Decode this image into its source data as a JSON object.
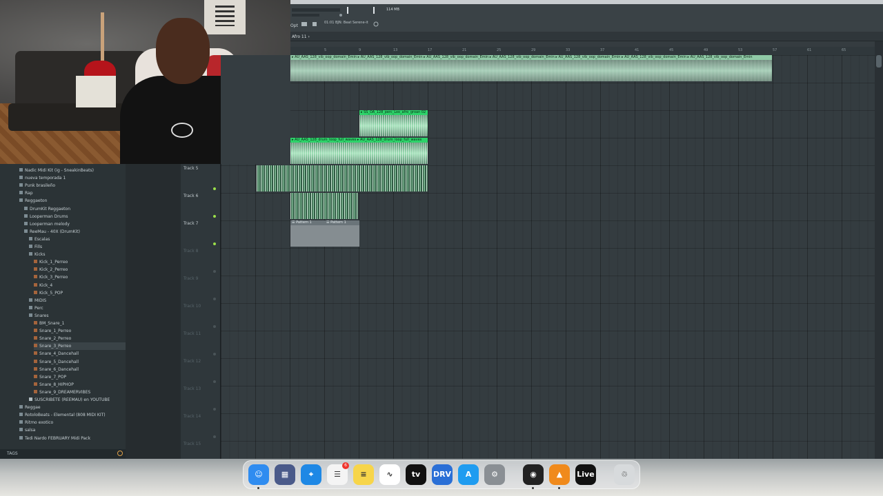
{
  "playlist": {
    "pattern_title": "Afro 11 ›",
    "opt_label": "Opt",
    "cpu_readout": "114 MB",
    "hint_text": "01:01 BJN: Beat Serene-it"
  },
  "timeline": {
    "ticks": [
      "5",
      "9",
      "13",
      "17",
      "21",
      "25",
      "29",
      "33",
      "37",
      "41",
      "45",
      "49",
      "53",
      "57",
      "61",
      "65",
      "69",
      "73"
    ]
  },
  "tracks": [
    {
      "label": "Track 5",
      "active": true
    },
    {
      "label": "Track 6",
      "active": true
    },
    {
      "label": "Track 7",
      "active": true
    },
    {
      "label": "Track 8",
      "active": false
    },
    {
      "label": "Track 9",
      "active": false
    },
    {
      "label": "Track 10",
      "active": false
    },
    {
      "label": "Track 11",
      "active": false
    },
    {
      "label": "Track 12",
      "active": false
    },
    {
      "label": "Track 13",
      "active": false
    },
    {
      "label": "Track 14",
      "active": false
    },
    {
      "label": "Track 15",
      "active": false
    }
  ],
  "clips": {
    "vocal_loop_label": "▸ AU_AAS_128_vib_oop_domain_Emin ▸ AU_AAS_128_vib_oop_domain_Emin ▸ AU_AAS_128_vib_oop_domain_Emin ▸ AU_AAS_128_vib_oop_domain_Emin ▸ AU_AAS_128_vib_oop_domain_Emin ▸ AU_AAS_128_vib_oop_domain_Emin ▸ AU_AAS_128_vib_oop_domain_Emin",
    "perc_loop_label": "▸ SS_OA_128_perc_Loo_afro_groan 02",
    "drum_loop_label": "▸ AU_AAS_128_drum_loop_full_waves ▸ AU_AAS_128_drum_loop_full_waves",
    "pattern_1_label": "☰ Pattern 1",
    "pattern_2_label": "☰ Pattern 1"
  },
  "browser": {
    "items": [
      {
        "label": "Nadic Midi Kit (ig - SneakinBeats)",
        "type": "folder",
        "indent": 0
      },
      {
        "label": "nueva temporada 1",
        "type": "folder",
        "indent": 0
      },
      {
        "label": "Punk brasileño",
        "type": "folder",
        "indent": 0
      },
      {
        "label": "Rap",
        "type": "folder",
        "indent": 0
      },
      {
        "label": "Reggaeton",
        "type": "folder",
        "indent": 0
      },
      {
        "label": "DrumKit Reggaeton",
        "type": "folder",
        "indent": 1
      },
      {
        "label": "Looperman Drums",
        "type": "folder",
        "indent": 1
      },
      {
        "label": "Looperman melody",
        "type": "folder",
        "indent": 1
      },
      {
        "label": "ReeMau - 40X (DrumKit)",
        "type": "folder",
        "indent": 1
      },
      {
        "label": "Escalas",
        "type": "folder",
        "indent": 2
      },
      {
        "label": "Fills",
        "type": "folder",
        "indent": 2
      },
      {
        "label": "Kicks",
        "type": "folder",
        "indent": 2
      },
      {
        "label": "Kick_1_Perreo",
        "type": "file",
        "indent": 3
      },
      {
        "label": "Kick_2_Perreo",
        "type": "file",
        "indent": 3
      },
      {
        "label": "Kick_3_Perreo",
        "type": "file",
        "indent": 3
      },
      {
        "label": "Kick_4",
        "type": "file",
        "indent": 3
      },
      {
        "label": "Kick_5_POP",
        "type": "file",
        "indent": 3
      },
      {
        "label": "MIDIS",
        "type": "folder",
        "indent": 2
      },
      {
        "label": "Perc",
        "type": "folder",
        "indent": 2
      },
      {
        "label": "Snares",
        "type": "folder",
        "indent": 2
      },
      {
        "label": "BM_Snare_1",
        "type": "file",
        "indent": 3
      },
      {
        "label": "Snare_1_Perreo",
        "type": "file",
        "indent": 3
      },
      {
        "label": "Snare_2_Perreo",
        "type": "file",
        "indent": 3
      },
      {
        "label": "Snare_3_Perreo",
        "type": "file",
        "indent": 3
      },
      {
        "label": "Snare_4_Dancehall",
        "type": "file",
        "indent": 3
      },
      {
        "label": "Snare_5_Dancehall",
        "type": "file",
        "indent": 3
      },
      {
        "label": "Snare_6_Dancehall",
        "type": "file",
        "indent": 3
      },
      {
        "label": "Snare_7_POP",
        "type": "file",
        "indent": 3
      },
      {
        "label": "Snare_8_HIPHOP",
        "type": "file",
        "indent": 3
      },
      {
        "label": "Snare_9_DREAMERVIBES",
        "type": "file",
        "indent": 3
      },
      {
        "label": "SUSCRIBETE (REEMAU) en YOUTUBE",
        "type": "audio",
        "indent": 2
      },
      {
        "label": "Reggae",
        "type": "folder",
        "indent": 0
      },
      {
        "label": "RotoloBeats - Elemental (808 MIDI KIT)",
        "type": "folder",
        "indent": 0
      },
      {
        "label": "Ritmo exotico",
        "type": "folder",
        "indent": 0
      },
      {
        "label": "salsa",
        "type": "folder",
        "indent": 0
      },
      {
        "label": "Tedi Nardo FEBRUARY Midi Pack",
        "type": "folder",
        "indent": 0
      }
    ],
    "selected_index": 23,
    "tags_label": "TAGS"
  },
  "dock": {
    "apps": [
      {
        "name": "Finder",
        "glyph": "☺",
        "color": "#2f8cf0"
      },
      {
        "name": "Launchpad",
        "glyph": "▦",
        "color": "#4a5a8a"
      },
      {
        "name": "Safari",
        "glyph": "⌖",
        "color": "#1e88e5"
      },
      {
        "name": "Reminders",
        "glyph": "☰",
        "color": "#f4f4f4"
      },
      {
        "name": "Notes",
        "glyph": "≡",
        "color": "#f7d54a"
      },
      {
        "name": "Freeform",
        "glyph": "∿",
        "color": "#ffffff"
      },
      {
        "name": "Apple TV",
        "glyph": "tv",
        "color": "#111111"
      },
      {
        "name": "Gemini",
        "glyph": "DRV",
        "color": "#2a6fd6"
      },
      {
        "name": "App Store",
        "glyph": "A",
        "color": "#1f9cf0"
      },
      {
        "name": "System Settings",
        "glyph": "⚙",
        "color": "#8a8f94"
      },
      {
        "name": "Logic",
        "glyph": "◉",
        "color": "#222222"
      },
      {
        "name": "FL Studio",
        "glyph": "▲",
        "color": "#f08a1c"
      },
      {
        "name": "Ableton Live",
        "glyph": "Live",
        "color": "#111111"
      },
      {
        "name": "Trash",
        "glyph": "♲",
        "color": "#d7dadc"
      }
    ],
    "reminders_badge": "6"
  }
}
